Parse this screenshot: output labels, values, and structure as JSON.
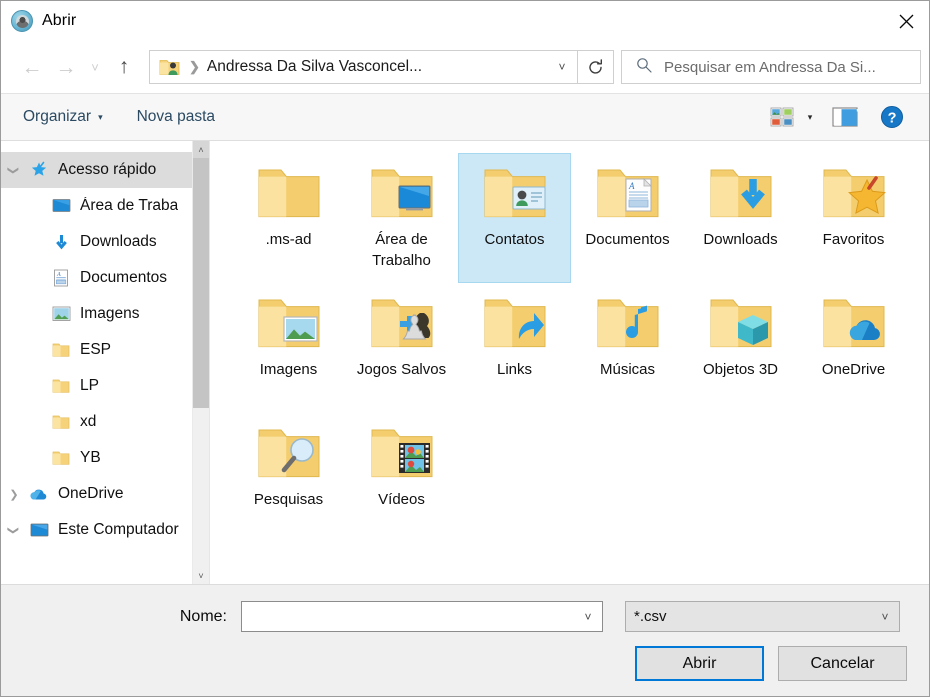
{
  "window": {
    "title": "Abrir",
    "app_icon": "app-circle-icon",
    "close_label": "×"
  },
  "nav": {
    "back_icon": "←",
    "forward_icon": "→",
    "recent_icon": "˅",
    "up_icon": "↑",
    "address": {
      "icon": "user-folder-icon",
      "separator": "❯",
      "path_text": "Andressa Da Silva Vasconcel...",
      "chevron": "˅"
    },
    "refresh_icon": "refresh-icon",
    "search": {
      "icon": "search-icon",
      "placeholder": "Pesquisar em Andressa Da Si..."
    }
  },
  "toolbar": {
    "organize_label": "Organizar",
    "organize_caret": "▾",
    "new_folder_label": "Nova pasta",
    "view_icon": "view-options-icon",
    "view_caret": "▾",
    "preview_pane_icon": "preview-pane-icon",
    "help_icon": "help-icon",
    "help_glyph": "?"
  },
  "sidebar": {
    "scroll": {
      "up_arrow": "˄",
      "down_arrow": "˅"
    },
    "items": [
      {
        "label": "Acesso rápido",
        "icon": "pin-star-icon",
        "twisty": "expanded",
        "selected": true,
        "indent": 0,
        "pinned": false
      },
      {
        "label": "Área de Traba",
        "icon": "desktop-icon",
        "twisty": "none",
        "selected": false,
        "indent": 1,
        "pinned": true
      },
      {
        "label": "Downloads",
        "icon": "download-icon",
        "twisty": "none",
        "selected": false,
        "indent": 1,
        "pinned": true
      },
      {
        "label": "Documentos",
        "icon": "document-icon",
        "twisty": "none",
        "selected": false,
        "indent": 1,
        "pinned": true
      },
      {
        "label": "Imagens",
        "icon": "pictures-icon",
        "twisty": "none",
        "selected": false,
        "indent": 1,
        "pinned": true
      },
      {
        "label": "ESP",
        "icon": "folder-icon",
        "twisty": "none",
        "selected": false,
        "indent": 1,
        "pinned": false
      },
      {
        "label": "LP",
        "icon": "folder-icon",
        "twisty": "none",
        "selected": false,
        "indent": 1,
        "pinned": false
      },
      {
        "label": "xd",
        "icon": "folder-icon",
        "twisty": "none",
        "selected": false,
        "indent": 1,
        "pinned": false
      },
      {
        "label": "YB",
        "icon": "folder-icon",
        "twisty": "none",
        "selected": false,
        "indent": 1,
        "pinned": false
      },
      {
        "label": "OneDrive",
        "icon": "cloud-icon",
        "twisty": "collapsed",
        "selected": false,
        "indent": 0,
        "pinned": false
      },
      {
        "label": "Este Computador",
        "icon": "computer-icon",
        "twisty": "expanded",
        "selected": false,
        "indent": 0,
        "pinned": false
      }
    ]
  },
  "files": [
    {
      "name": ".ms-ad",
      "icon": "folder-plain-icon",
      "selected": false
    },
    {
      "name": "Área de Trabalho",
      "icon": "folder-desktop-icon",
      "selected": false
    },
    {
      "name": "Contatos",
      "icon": "folder-contacts-icon",
      "selected": true
    },
    {
      "name": "Documentos",
      "icon": "folder-documents-icon",
      "selected": false
    },
    {
      "name": "Downloads",
      "icon": "folder-downloads-icon",
      "selected": false
    },
    {
      "name": "Favoritos",
      "icon": "folder-favorites-icon",
      "selected": false
    },
    {
      "name": "Imagens",
      "icon": "folder-pictures-icon",
      "selected": false
    },
    {
      "name": "Jogos Salvos",
      "icon": "folder-games-icon",
      "selected": false
    },
    {
      "name": "Links",
      "icon": "folder-links-icon",
      "selected": false
    },
    {
      "name": "Músicas",
      "icon": "folder-music-icon",
      "selected": false
    },
    {
      "name": "Objetos 3D",
      "icon": "folder-3d-icon",
      "selected": false
    },
    {
      "name": "OneDrive",
      "icon": "folder-onedrive-icon",
      "selected": false
    },
    {
      "name": "Pesquisas",
      "icon": "folder-searches-icon",
      "selected": false
    },
    {
      "name": "Vídeos",
      "icon": "folder-videos-icon",
      "selected": false
    }
  ],
  "footer": {
    "name_label": "Nome:",
    "name_value": "",
    "name_chevron": "˅",
    "filetype_value": "*.csv",
    "filetype_chevron": "˅",
    "open_label": "Abrir",
    "cancel_label": "Cancelar"
  },
  "colors": {
    "accent": "#0078d7",
    "selection_fill": "#cce8f7",
    "selection_border": "#a8d8f0",
    "toolbar_text": "#2b4a62",
    "folder_yellow": "#f8d775"
  }
}
